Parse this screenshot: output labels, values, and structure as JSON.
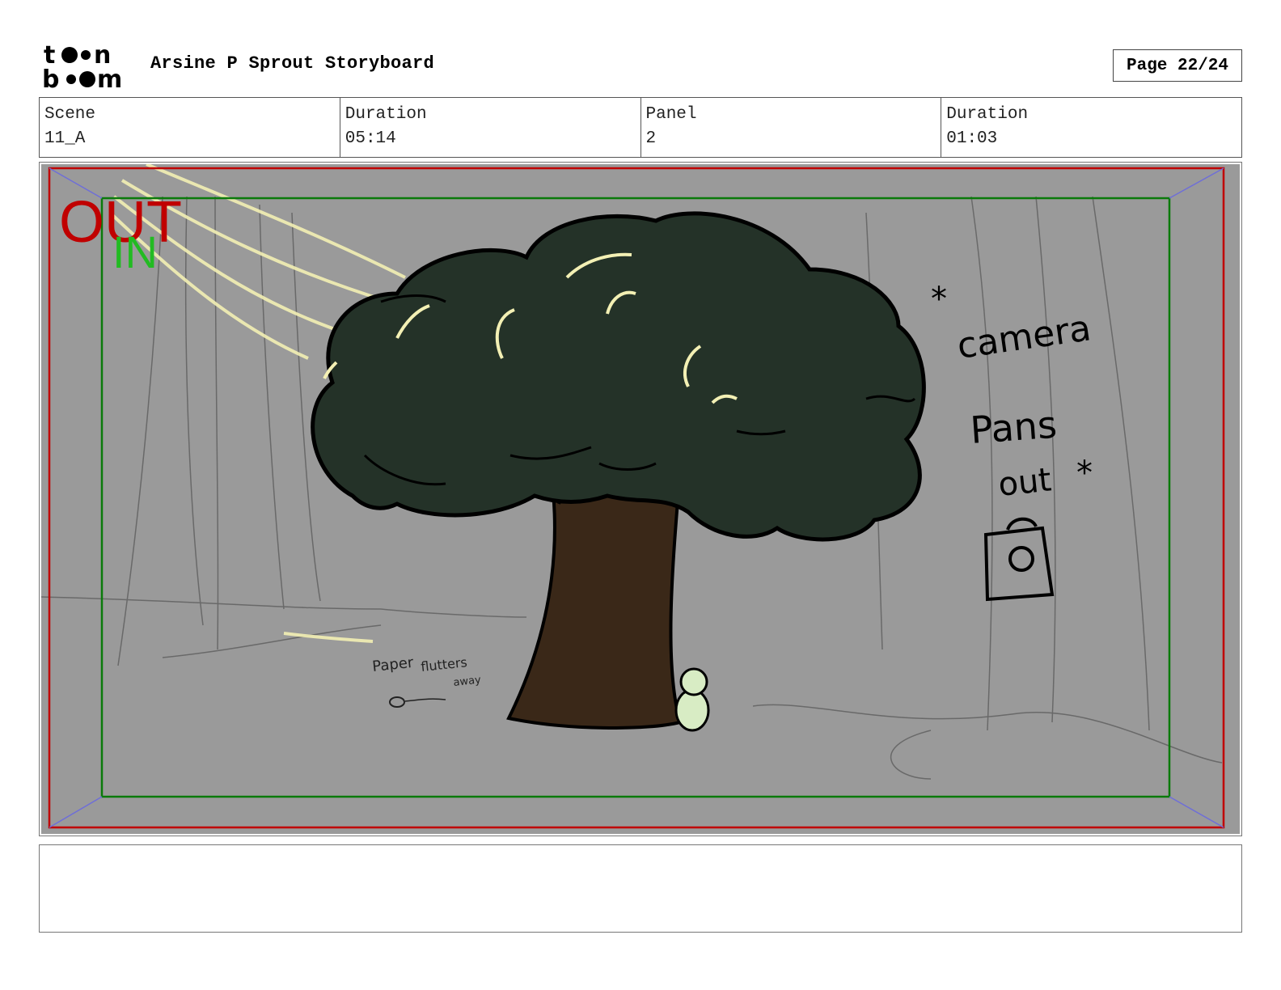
{
  "header": {
    "logo_text": "toon boom",
    "title": "Arsine P Sprout Storyboard",
    "page_label": "Page 22/24"
  },
  "info": {
    "scene_label": "Scene",
    "scene_value": "11_A",
    "scene_duration_label": "Duration",
    "scene_duration_value": "05:14",
    "panel_label": "Panel",
    "panel_value": "2",
    "panel_duration_label": "Duration",
    "panel_duration_value": "01:03"
  },
  "frame": {
    "out_label": "OUT",
    "in_label": "IN",
    "out_color": "#c00000",
    "in_color": "#22bb22"
  },
  "sketch": {
    "note_camera": "*camera Pans out*",
    "note_paper": "Paper flutters away"
  },
  "notes": {
    "text": ""
  },
  "colors": {
    "background": "#9a9a9a",
    "foliage": "#243228",
    "trunk": "#3a2818",
    "highlight": "#f3f0b4"
  }
}
